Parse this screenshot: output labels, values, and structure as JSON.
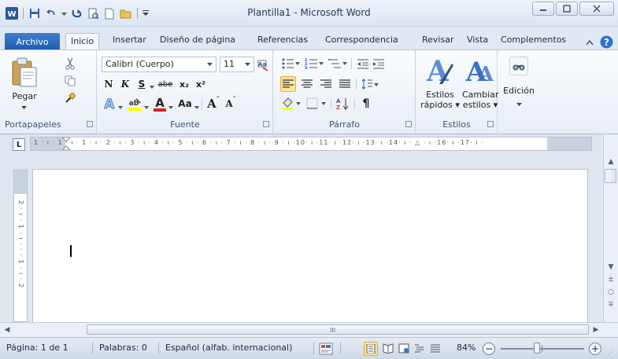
{
  "window": {
    "title": "Plantilla1  -  Microsoft Word",
    "app_icon_letter": "W"
  },
  "tabs": {
    "file": "Archivo",
    "items": [
      "Inicio",
      "Insertar",
      "Diseño de página",
      "Referencias",
      "Correspondencia",
      "Revisar",
      "Vista",
      "Complementos"
    ],
    "active": "Inicio"
  },
  "ribbon": {
    "clipboard": {
      "label": "Portapapeles",
      "paste": "Pegar"
    },
    "font": {
      "label": "Fuente",
      "font_name": "Calibri (Cuerpo)",
      "font_size": "11",
      "bold": "N",
      "italic": "K",
      "underline": "S",
      "strike": "abe",
      "subscript": "x₂",
      "superscript": "x²",
      "change_case": "Aa",
      "grow": "A",
      "shrink": "A"
    },
    "paragraph": {
      "label": "Párrafo"
    },
    "styles": {
      "label": "Estilos",
      "quick_styles": [
        "Estilos",
        "rápidos ▾"
      ],
      "change_styles": [
        "Cambiar",
        "estilos ▾"
      ]
    },
    "editing": {
      "label": "Edición"
    }
  },
  "ruler": {
    "numbers": "1 · ı · 1 · ı · 1 · ı · 2 · ı · 3 · ı · 4 · ı · 5 · ı · 6 · ı · 7 · ı · 8 · ı · 9 · ı ·10· ı ·11· ı ·12· ı ·13· ı ·14· ı · △ · ı ·16· ı ·17· ı ·",
    "vnumbers": "2 · ı · 1 · ı · · · 1 · ı · 2"
  },
  "statusbar": {
    "page": "Página: 1 de 1",
    "words": "Palabras: 0",
    "language": "Español (alfab. internacional)",
    "zoom": "84%"
  },
  "colors": {
    "file_tab": "#1d5ab0",
    "accent": "#2b579a"
  }
}
